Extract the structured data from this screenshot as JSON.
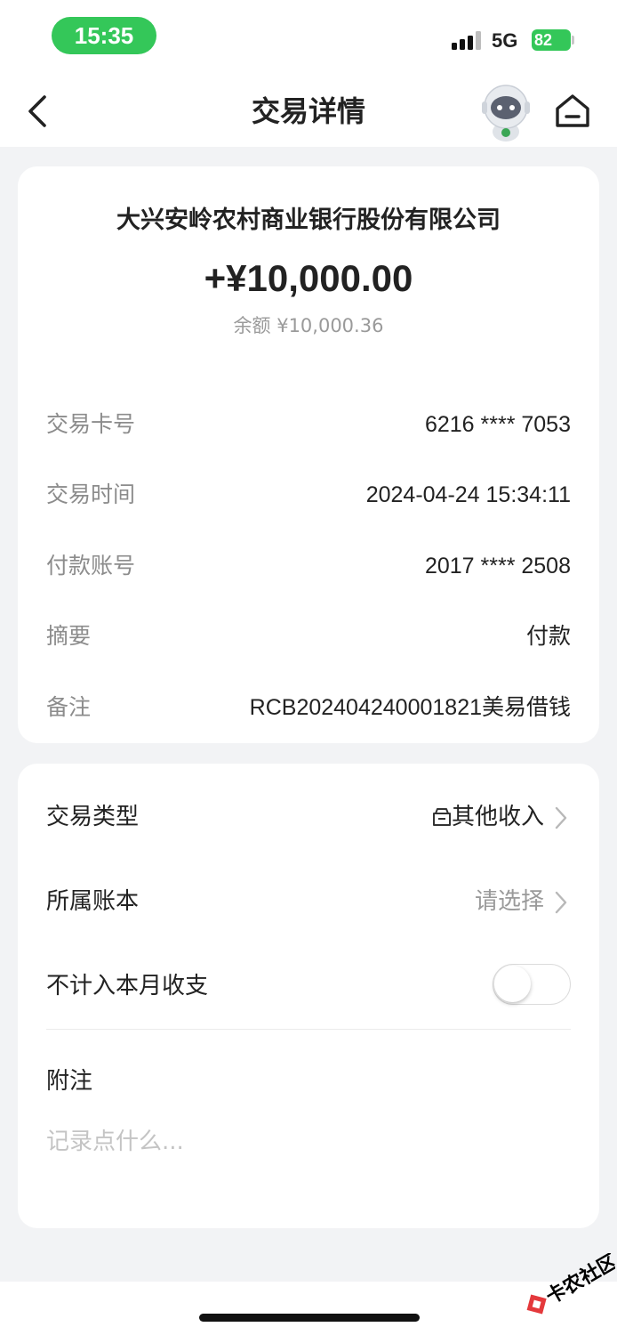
{
  "status_bar": {
    "time": "15:35",
    "network": "5G",
    "battery": "82",
    "accent_color": "#34c759"
  },
  "header": {
    "title": "交易详情",
    "back_icon": "chevron-left-icon",
    "mascot_icon": "astronaut-mascot-icon",
    "home_icon": "home-icon"
  },
  "transaction": {
    "bank_name": "大兴安岭农村商业银行股份有限公司",
    "amount": "+¥10,000.00",
    "balance_line": "余额 ¥10,000.36",
    "details": [
      {
        "label": "交易卡号",
        "value": "6216 **** 7053"
      },
      {
        "label": "交易时间",
        "value": "2024-04-24 15:34:11"
      },
      {
        "label": "付款账号",
        "value": "2017 **** 2508"
      },
      {
        "label": "摘要",
        "value": "付款"
      },
      {
        "label": "备注",
        "value": "RCB20240424000182​1美易借钱"
      }
    ]
  },
  "settings": {
    "type_label": "交易类型",
    "type_value": "其他收入",
    "type_icon": "income-box-icon",
    "book_label": "所属账本",
    "book_value": "请选择",
    "exclude_label": "不计入本月收支",
    "exclude_enabled": false,
    "note_label": "附注",
    "note_placeholder": "记录点什么..."
  },
  "watermark": {
    "text": "卡农社区"
  }
}
